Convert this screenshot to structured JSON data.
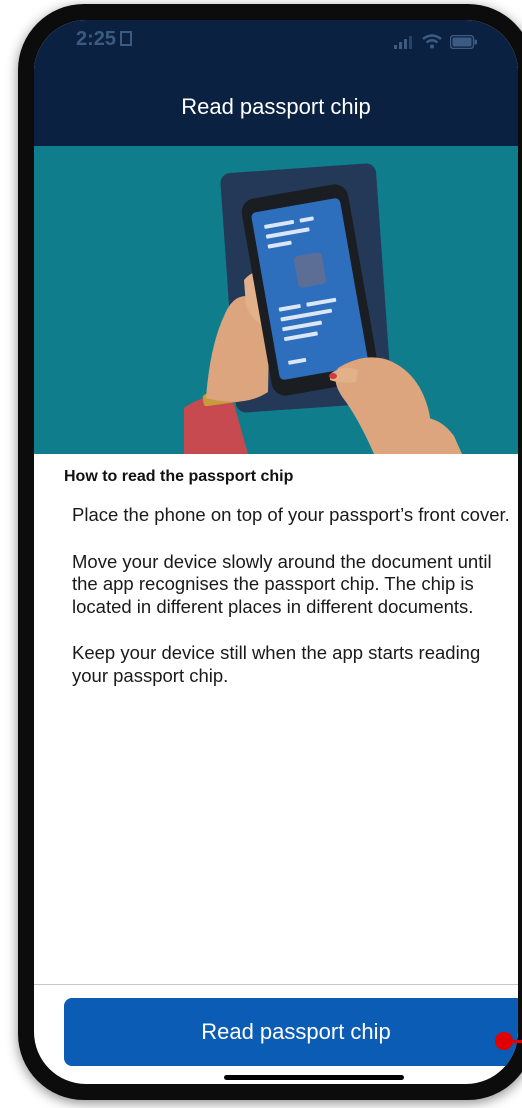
{
  "status_bar": {
    "time": "2:25"
  },
  "header": {
    "title": "Read passport chip"
  },
  "content": {
    "heading": "How to read the passport chip",
    "paragraphs": [
      "Place the phone on top of your passport’s front cover.",
      "Move your device slowly around the document until the app recognises the passport chip. The chip is located in different places in different documents.",
      "Keep your device still when the app starts reading your passport chip."
    ]
  },
  "footer": {
    "primary_button_label": "Read passport chip"
  },
  "colors": {
    "header_bg": "#0b2142",
    "hero_bg": "#0f7d8c",
    "button_bg": "#0b5cb4",
    "marker": "#e10000"
  },
  "icons": {
    "signal": "cellular-signal-icon",
    "wifi": "wifi-icon",
    "battery": "battery-icon"
  }
}
